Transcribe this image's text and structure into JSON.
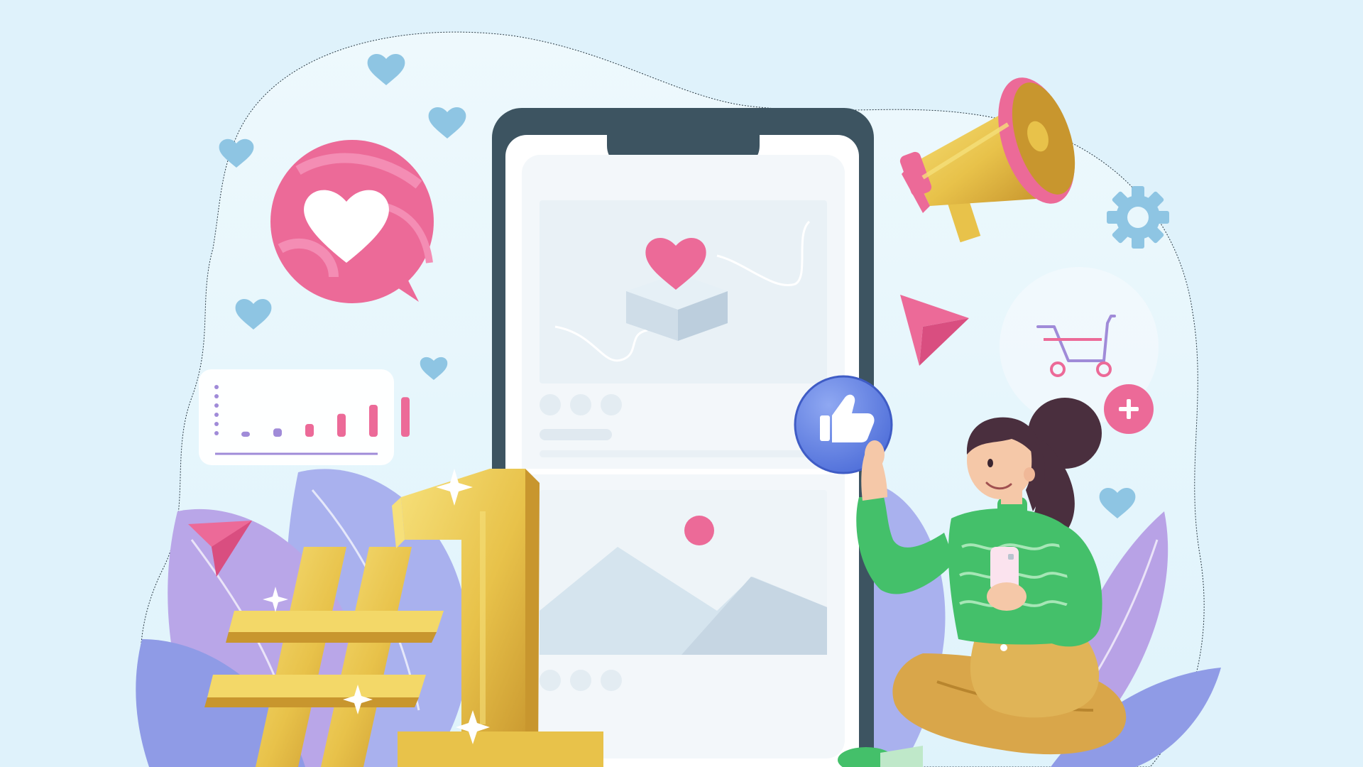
{
  "illustration": {
    "symbol": "#1",
    "icons": [
      "heart-speech-bubble-icon",
      "bar-chart-card-icon",
      "smartphone-icon",
      "megaphone-icon",
      "gear-icon",
      "shopping-cart-icon",
      "plus-icon",
      "thumbs-up-icon",
      "paper-plane-icon",
      "heart-icon",
      "image-placeholder-icon",
      "number-one-trophy-icon",
      "woman-character"
    ],
    "chart_bar_levels": [
      0.08,
      0.13,
      0.2,
      0.36,
      0.5,
      0.62
    ],
    "colors": {
      "background": "#dff2fb",
      "blob": "#e9f7fc",
      "phone_frame": "#3d5461",
      "phone_screen": "#f3f7fa",
      "pink_accent": "#ec6a98",
      "gold": "#e8c24a",
      "gold_dark": "#c8962e",
      "purple_leaf": "#9ca6e8",
      "like_blue": "#5b7ee0",
      "sweater_green": "#44c06a",
      "pants_tan": "#d9a64a",
      "hair": "#4a2f3e",
      "heart_blue": "#8ec5e3"
    }
  }
}
